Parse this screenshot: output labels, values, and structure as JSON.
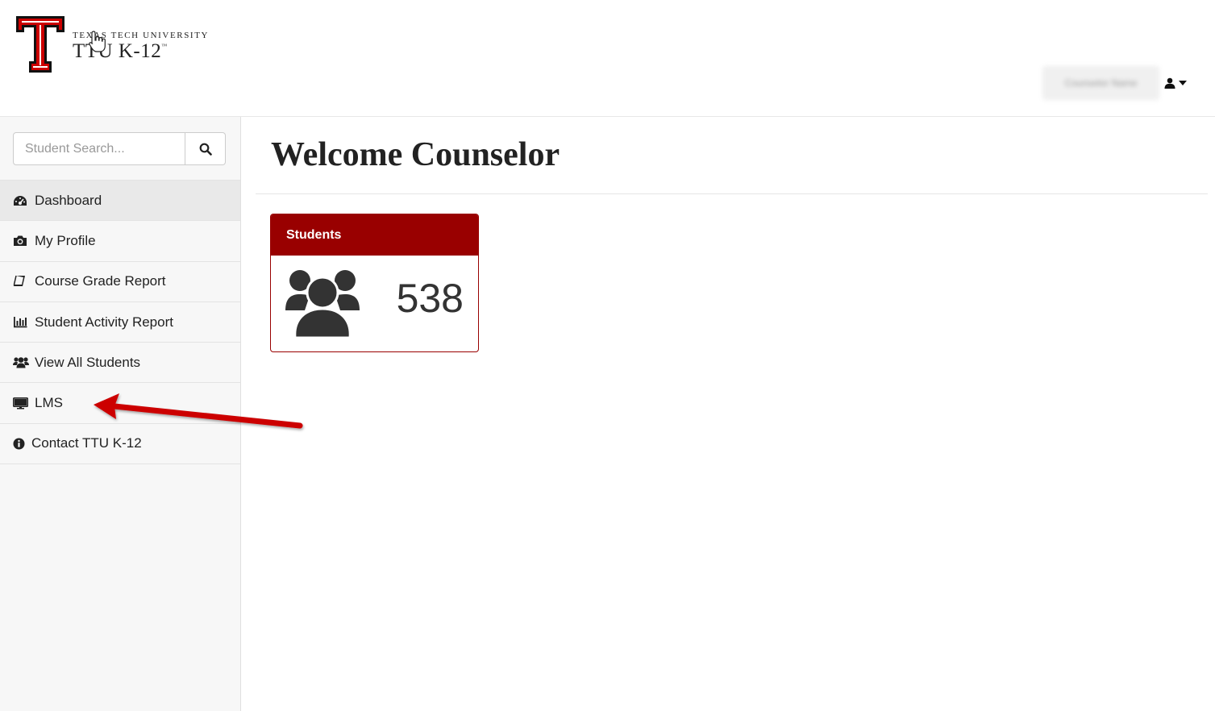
{
  "header": {
    "brand_top": "TEXAS TECH UNIVERSITY",
    "brand_main": "TTU K-12",
    "brand_tm": "™",
    "user_name": "Counselor Name"
  },
  "sidebar": {
    "search_placeholder": "Student Search...",
    "items": [
      {
        "label": "Dashboard",
        "icon": "dashboard-icon"
      },
      {
        "label": "My Profile",
        "icon": "camera-icon"
      },
      {
        "label": "Course Grade Report",
        "icon": "book-icon"
      },
      {
        "label": "Student Activity Report",
        "icon": "bar-chart-icon"
      },
      {
        "label": "View All Students",
        "icon": "users-icon"
      },
      {
        "label": "LMS",
        "icon": "desktop-icon"
      },
      {
        "label": "Contact TTU K-12",
        "icon": "info-icon"
      }
    ]
  },
  "main": {
    "title": "Welcome Counselor",
    "panel": {
      "heading": "Students",
      "count": "538"
    }
  },
  "colors": {
    "brand_red": "#990000",
    "logo_red": "#cc0000",
    "annotation_arrow": "#cc0000"
  }
}
